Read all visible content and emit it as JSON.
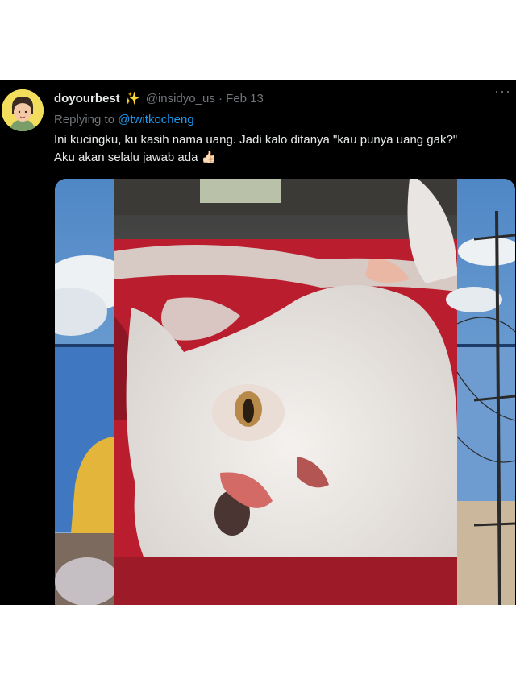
{
  "tweet": {
    "display_name": "doyourbest",
    "name_emoji": "✨",
    "handle": "@insidyo_us",
    "separator": "·",
    "date": "Feb 13",
    "more_icon": "more-horizontal-icon",
    "replying_prefix": "Replying to ",
    "replying_to": "@twitkocheng",
    "text_line1": "Ini kucingku, ku kasih nama uang. Jadi kalo ditanya \"kau punya uang gak?\"",
    "text_line2": "Aku akan selalu jawab ada",
    "text_emoji": "👍🏻"
  },
  "colors": {
    "background": "#000000",
    "text": "#e7e9ea",
    "secondary": "#71767b",
    "link": "#1d9bf0"
  }
}
